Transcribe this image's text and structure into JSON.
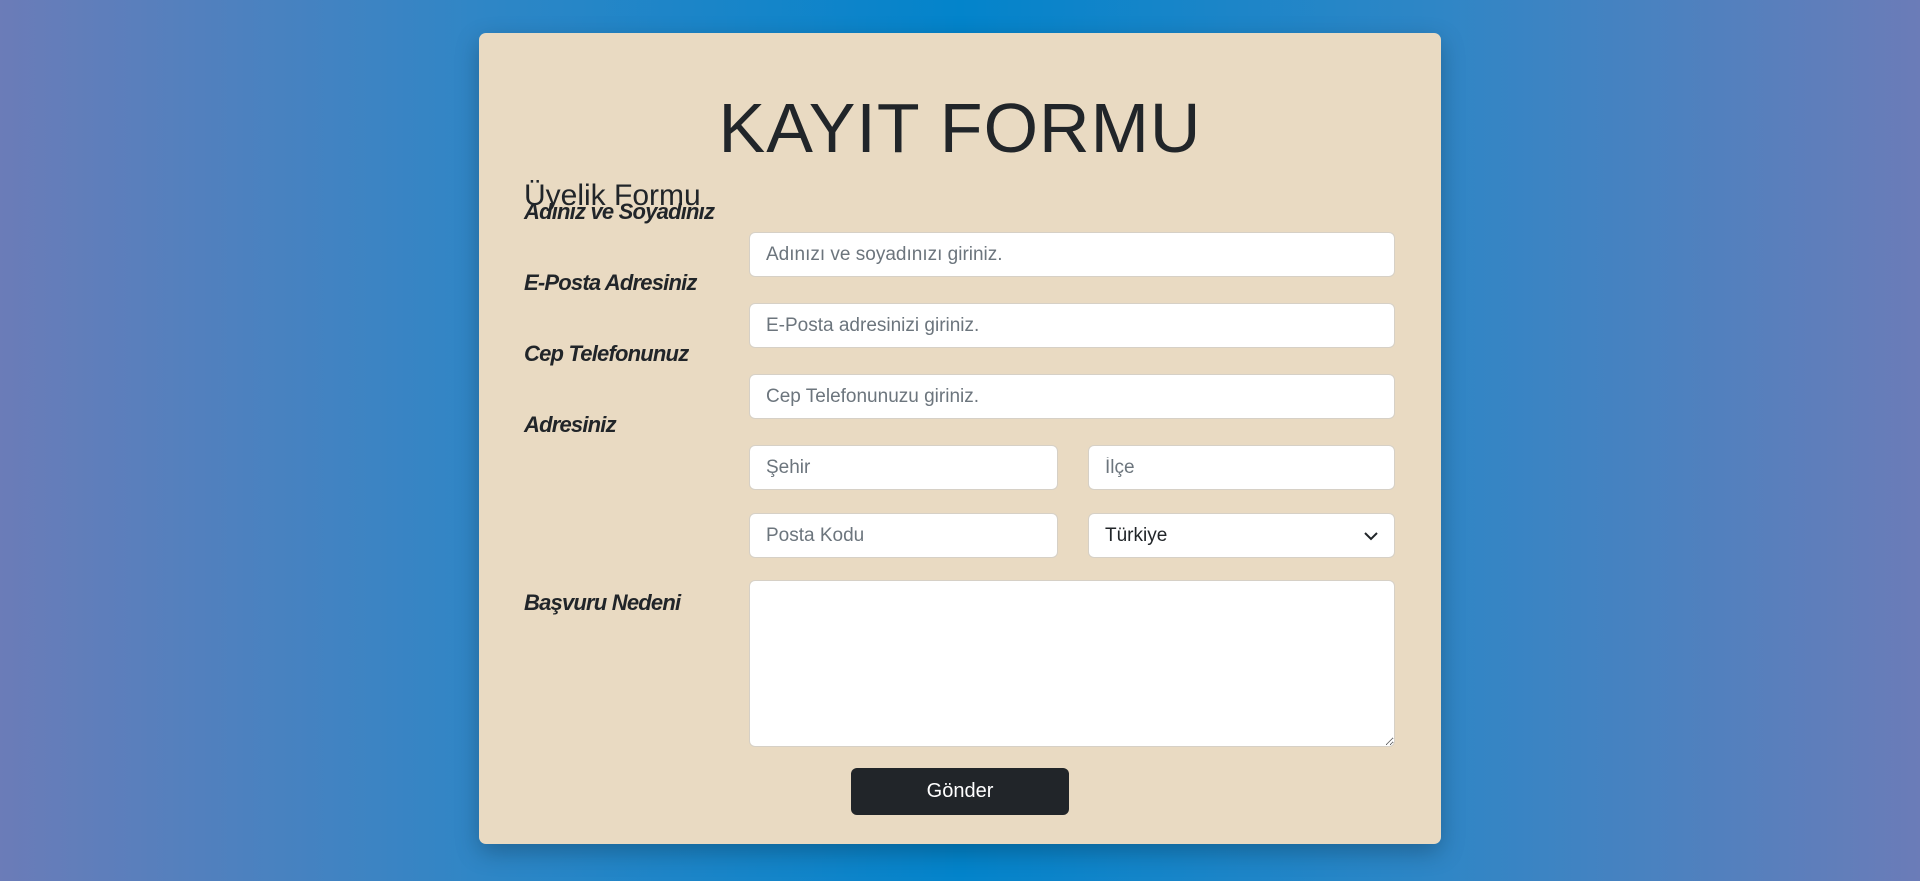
{
  "form": {
    "title": "KAYIT FORMU",
    "subtitle": "Üyelik Formu",
    "fields": {
      "name": {
        "label": "Adınız ve Soyadınız",
        "placeholder": "Adınızı ve soyadınızı giriniz.",
        "value": ""
      },
      "email": {
        "label": "E-Posta Adresiniz",
        "placeholder": "E-Posta adresinizi giriniz.",
        "value": ""
      },
      "phone": {
        "label": "Cep Telefonunuz",
        "placeholder": "Cep Telefonunuzu giriniz.",
        "value": ""
      },
      "address": {
        "label": "Adresiniz",
        "city_placeholder": "Şehir",
        "district_placeholder": "İlçe",
        "postal_placeholder": "Posta Kodu",
        "country_selected": "Türkiye"
      },
      "reason": {
        "label": "Başvuru Nedeni",
        "value": ""
      }
    },
    "submit_label": "Gönder"
  },
  "colors": {
    "card": "#e9dac2",
    "button": "#212529",
    "background_center": "#0384cb",
    "background_edge": "#6b7cb8"
  }
}
